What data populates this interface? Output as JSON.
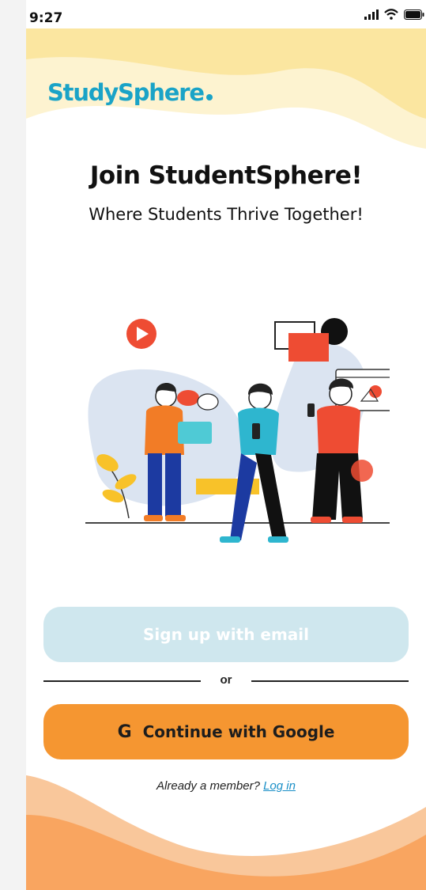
{
  "status_bar": {
    "time": "9:27"
  },
  "brand": {
    "logo_text": "StudySphere",
    "accent": "#1aa3c7"
  },
  "hero": {
    "title": "Join StudentSphere!",
    "subtitle": "Where Students Thrive Together!"
  },
  "actions": {
    "email_label": "Sign up with email",
    "divider_label": "or",
    "google_icon": "G",
    "google_label": "Continue with Google"
  },
  "footer": {
    "prompt": "Already a member?",
    "login_link": "Log in"
  },
  "colors": {
    "top_wave": "#fbe9a9",
    "bottom_wave": "#f9a560",
    "email_button": "#cfe7ee",
    "google_button": "#f59631"
  }
}
